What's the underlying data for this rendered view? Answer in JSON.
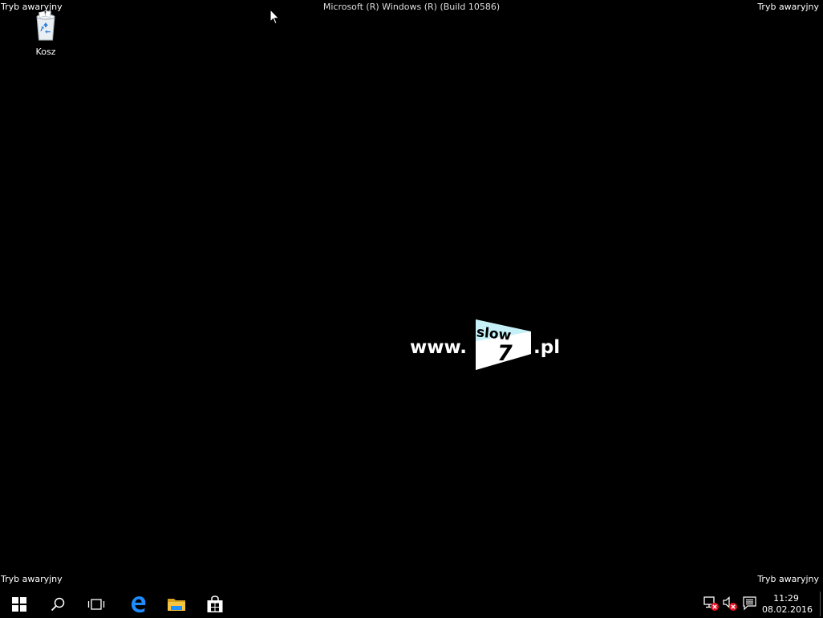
{
  "overlay": {
    "safe_mode_label": "Tryb awaryjny",
    "build_text": "Microsoft (R) Windows (R) (Build 10586)"
  },
  "desktop": {
    "icons": [
      {
        "label": "Kosz",
        "icon": "recycle-bin-icon"
      }
    ],
    "watermark": {
      "prefix": "www.",
      "logo_top": "slow",
      "logo_number": "7",
      "suffix": ".pl"
    }
  },
  "taskbar": {
    "buttons": [
      {
        "name": "start-button",
        "icon": "windows-logo-icon"
      },
      {
        "name": "search-button",
        "icon": "search-icon"
      },
      {
        "name": "task-view-button",
        "icon": "task-view-icon"
      },
      {
        "name": "edge-button",
        "icon": "edge-icon"
      },
      {
        "name": "file-explorer-button",
        "icon": "folder-icon"
      },
      {
        "name": "store-button",
        "icon": "store-icon"
      }
    ],
    "tray": {
      "icons": [
        "network-disconnected-icon",
        "volume-muted-icon",
        "action-center-icon"
      ],
      "time": "11:29",
      "date": "08.02.2016"
    }
  },
  "colors": {
    "background": "#000000",
    "accent_blue": "#1e90ff",
    "folder_yellow": "#f6c443",
    "error_red": "#e81123",
    "logo_cyan": "#c6f0f7"
  }
}
